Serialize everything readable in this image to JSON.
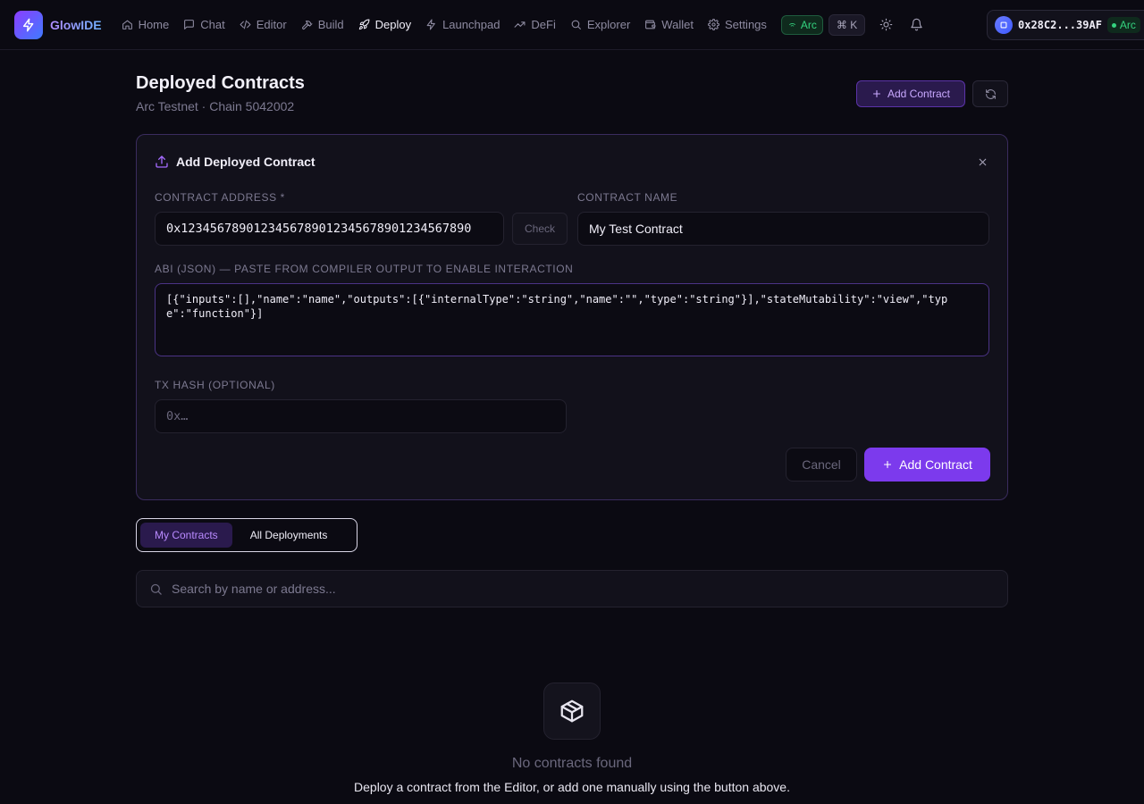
{
  "app": {
    "name": "GlowIDE"
  },
  "nav": {
    "links": [
      {
        "label": "Home",
        "icon": "home-icon"
      },
      {
        "label": "Chat",
        "icon": "chat-icon"
      },
      {
        "label": "Editor",
        "icon": "code-icon"
      },
      {
        "label": "Build",
        "icon": "hammer-icon"
      },
      {
        "label": "Deploy",
        "icon": "rocket-icon",
        "active": true
      },
      {
        "label": "Launchpad",
        "icon": "zap-icon"
      },
      {
        "label": "DeFi",
        "icon": "trending-up-icon"
      },
      {
        "label": "Explorer",
        "icon": "search-icon"
      },
      {
        "label": "Wallet",
        "icon": "wallet-icon"
      },
      {
        "label": "Settings",
        "icon": "gear-icon"
      }
    ],
    "network_badge": "Arc",
    "command_shortcut": "⌘ K",
    "wallet_address": "0x28C2...39AF",
    "wallet_network": "Arc"
  },
  "page": {
    "title": "Deployed Contracts",
    "subtitle": "Arc Testnet · Chain 5042002",
    "add_button": "Add Contract"
  },
  "add_form": {
    "title": "Add Deployed Contract",
    "address_label": "CONTRACT ADDRESS *",
    "address_value": "0x1234567890123456789012345678901234567890",
    "check_button": "Check",
    "name_label": "CONTRACT NAME",
    "name_value": "My Test Contract",
    "abi_label": "ABI (JSON) — PASTE FROM COMPILER OUTPUT TO ENABLE INTERACTION",
    "abi_value": "[{\"inputs\":[],\"name\":\"name\",\"outputs\":[{\"internalType\":\"string\",\"name\":\"\",\"type\":\"string\"}],\"stateMutability\":\"view\",\"type\":\"function\"}]",
    "txhash_label": "TX HASH (OPTIONAL)",
    "txhash_placeholder": "0x…",
    "cancel_button": "Cancel",
    "submit_button": "Add Contract"
  },
  "tabs": [
    {
      "label": "My Contracts",
      "active": true
    },
    {
      "label": "All Deployments",
      "active": false
    }
  ],
  "search": {
    "placeholder": "Search by name or address..."
  },
  "empty_state": {
    "title": "No contracts found",
    "message": "Deploy a contract from the Editor, or add one manually using the button above."
  },
  "colors": {
    "accent": "#7c3aed",
    "success": "#34d37f",
    "background": "#0b0a12"
  }
}
